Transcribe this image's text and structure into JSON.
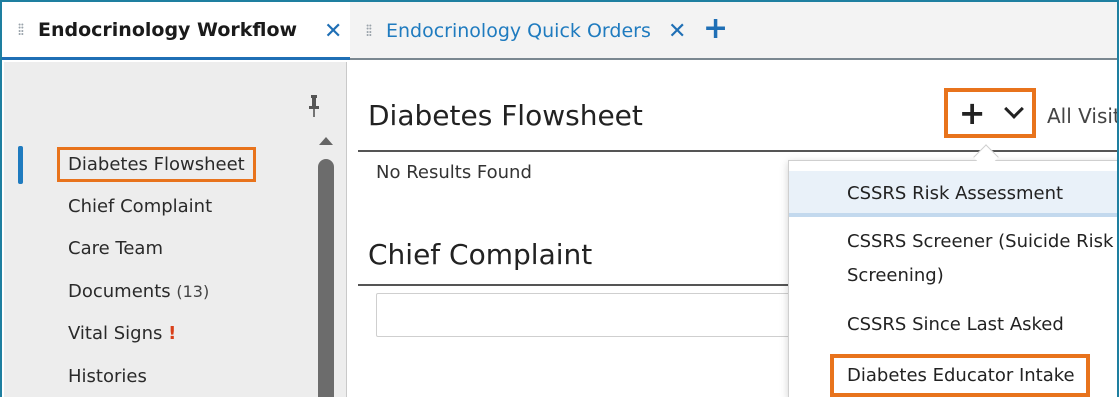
{
  "tabs": [
    {
      "label": "Endocrinology Workflow",
      "active": true
    },
    {
      "label": "Endocrinology Quick Orders",
      "active": false
    }
  ],
  "icons": {
    "grip": "drag-grip-icon",
    "close": "close-icon",
    "add_tab": "plus-icon",
    "pin": "pin-icon",
    "alert": "exclamation-icon",
    "chevron": "chevron-down-icon"
  },
  "nav": {
    "items": [
      {
        "label": "Diabetes Flowsheet",
        "active": true,
        "highlighted": true
      },
      {
        "label": "Chief Complaint"
      },
      {
        "label": "Care Team"
      },
      {
        "label": "Documents",
        "badge": "(13)"
      },
      {
        "label": "Vital Signs",
        "alert": "!"
      },
      {
        "label": "Histories"
      }
    ]
  },
  "main": {
    "flowsheet_title": "Diabetes Flowsheet",
    "no_results": "No Results Found",
    "chief_complaint_title": "Chief Complaint",
    "add_symbol": "+",
    "filter_label": "All Visits"
  },
  "dropdown": {
    "items": [
      {
        "label": "CSSRS Risk Assessment"
      },
      {
        "label": "CSSRS Screener (Suicide Risk Screening)",
        "line1": "CSSRS Screener (Suicide Risk",
        "line2": "Screening)"
      },
      {
        "label": "CSSRS Since Last Asked"
      },
      {
        "label": "Diabetes Educator Intake",
        "highlighted": true
      }
    ]
  },
  "colors": {
    "accent": "#1f6fb5",
    "highlight": "#e8731c",
    "alert": "#d9401a"
  }
}
